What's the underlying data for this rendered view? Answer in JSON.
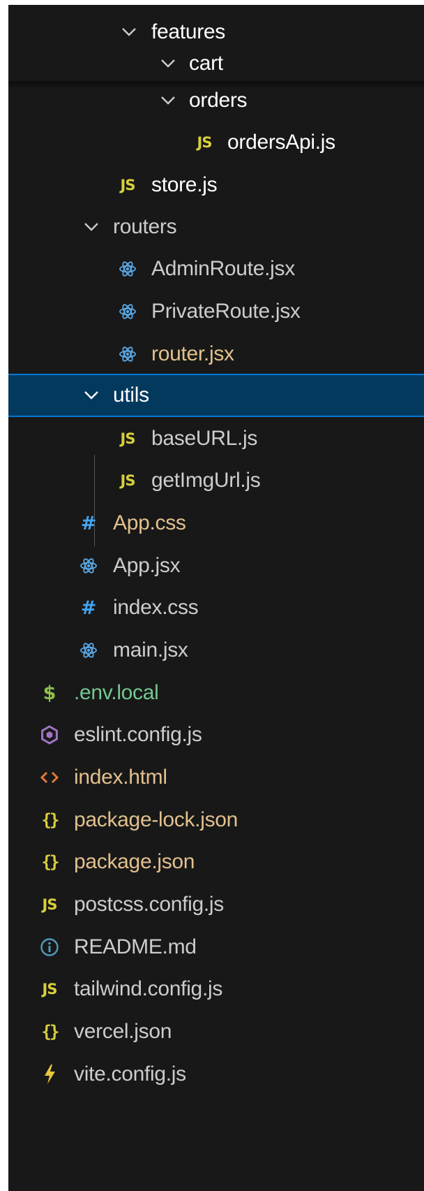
{
  "explorer": {
    "items": [
      {
        "label": "features",
        "kind": "folder",
        "icon": "chevron-down-icon",
        "status": "normal"
      },
      {
        "label": "cart",
        "kind": "folder",
        "icon": "chevron-down-icon",
        "status": "normal"
      },
      {
        "label": "orders",
        "kind": "folder",
        "icon": "chevron-down-icon",
        "status": "normal"
      },
      {
        "label": "ordersApi.js",
        "kind": "file",
        "icon": "javascript-icon",
        "icon_text": "JS",
        "status": "normal"
      },
      {
        "label": "store.js",
        "kind": "file",
        "icon": "javascript-icon",
        "icon_text": "JS",
        "status": "normal"
      },
      {
        "label": "routers",
        "kind": "folder",
        "icon": "chevron-down-icon",
        "status": "normal"
      },
      {
        "label": "AdminRoute.jsx",
        "kind": "file",
        "icon": "react-icon",
        "status": "normal"
      },
      {
        "label": "PrivateRoute.jsx",
        "kind": "file",
        "icon": "react-icon",
        "status": "normal"
      },
      {
        "label": "router.jsx",
        "kind": "file",
        "icon": "react-icon",
        "status": "modified"
      },
      {
        "label": "utils",
        "kind": "folder",
        "icon": "chevron-down-icon",
        "status": "selected"
      },
      {
        "label": "baseURL.js",
        "kind": "file",
        "icon": "javascript-icon",
        "icon_text": "JS",
        "status": "normal"
      },
      {
        "label": "getImgUrl.js",
        "kind": "file",
        "icon": "javascript-icon",
        "icon_text": "JS",
        "status": "normal"
      },
      {
        "label": "App.css",
        "kind": "file",
        "icon": "css-hash-icon",
        "icon_text": "#",
        "status": "modified"
      },
      {
        "label": "App.jsx",
        "kind": "file",
        "icon": "react-icon",
        "status": "normal"
      },
      {
        "label": "index.css",
        "kind": "file",
        "icon": "css-hash-icon",
        "icon_text": "#",
        "status": "normal"
      },
      {
        "label": "main.jsx",
        "kind": "file",
        "icon": "react-icon",
        "status": "normal"
      },
      {
        "label": ".env.local",
        "kind": "file",
        "icon": "dollar-icon",
        "icon_text": "$",
        "status": "untracked"
      },
      {
        "label": "eslint.config.js",
        "kind": "file",
        "icon": "eslint-icon",
        "status": "normal"
      },
      {
        "label": "index.html",
        "kind": "file",
        "icon": "html-icon",
        "status": "modified"
      },
      {
        "label": "package-lock.json",
        "kind": "file",
        "icon": "json-braces-icon",
        "icon_text": "{}",
        "status": "modified"
      },
      {
        "label": "package.json",
        "kind": "file",
        "icon": "json-braces-icon",
        "icon_text": "{}",
        "status": "modified"
      },
      {
        "label": "postcss.config.js",
        "kind": "file",
        "icon": "javascript-icon",
        "icon_text": "JS",
        "status": "normal"
      },
      {
        "label": "README.md",
        "kind": "file",
        "icon": "info-icon",
        "status": "normal"
      },
      {
        "label": "tailwind.config.js",
        "kind": "file",
        "icon": "javascript-icon",
        "icon_text": "JS",
        "status": "normal"
      },
      {
        "label": "vercel.json",
        "kind": "file",
        "icon": "json-braces-icon",
        "icon_text": "{}",
        "status": "normal"
      },
      {
        "label": "vite.config.js",
        "kind": "file",
        "icon": "vite-bolt-icon",
        "status": "normal"
      }
    ]
  },
  "colors": {
    "background": "#181818",
    "selection": "#04395e",
    "selection_border": "#0078d4",
    "text": "#cccccc",
    "modified": "#e2c08d",
    "untracked": "#73c991",
    "js_yellow": "#d8cf3c",
    "react_blue": "#5aa9e6",
    "css_blue": "#42a5f5"
  }
}
